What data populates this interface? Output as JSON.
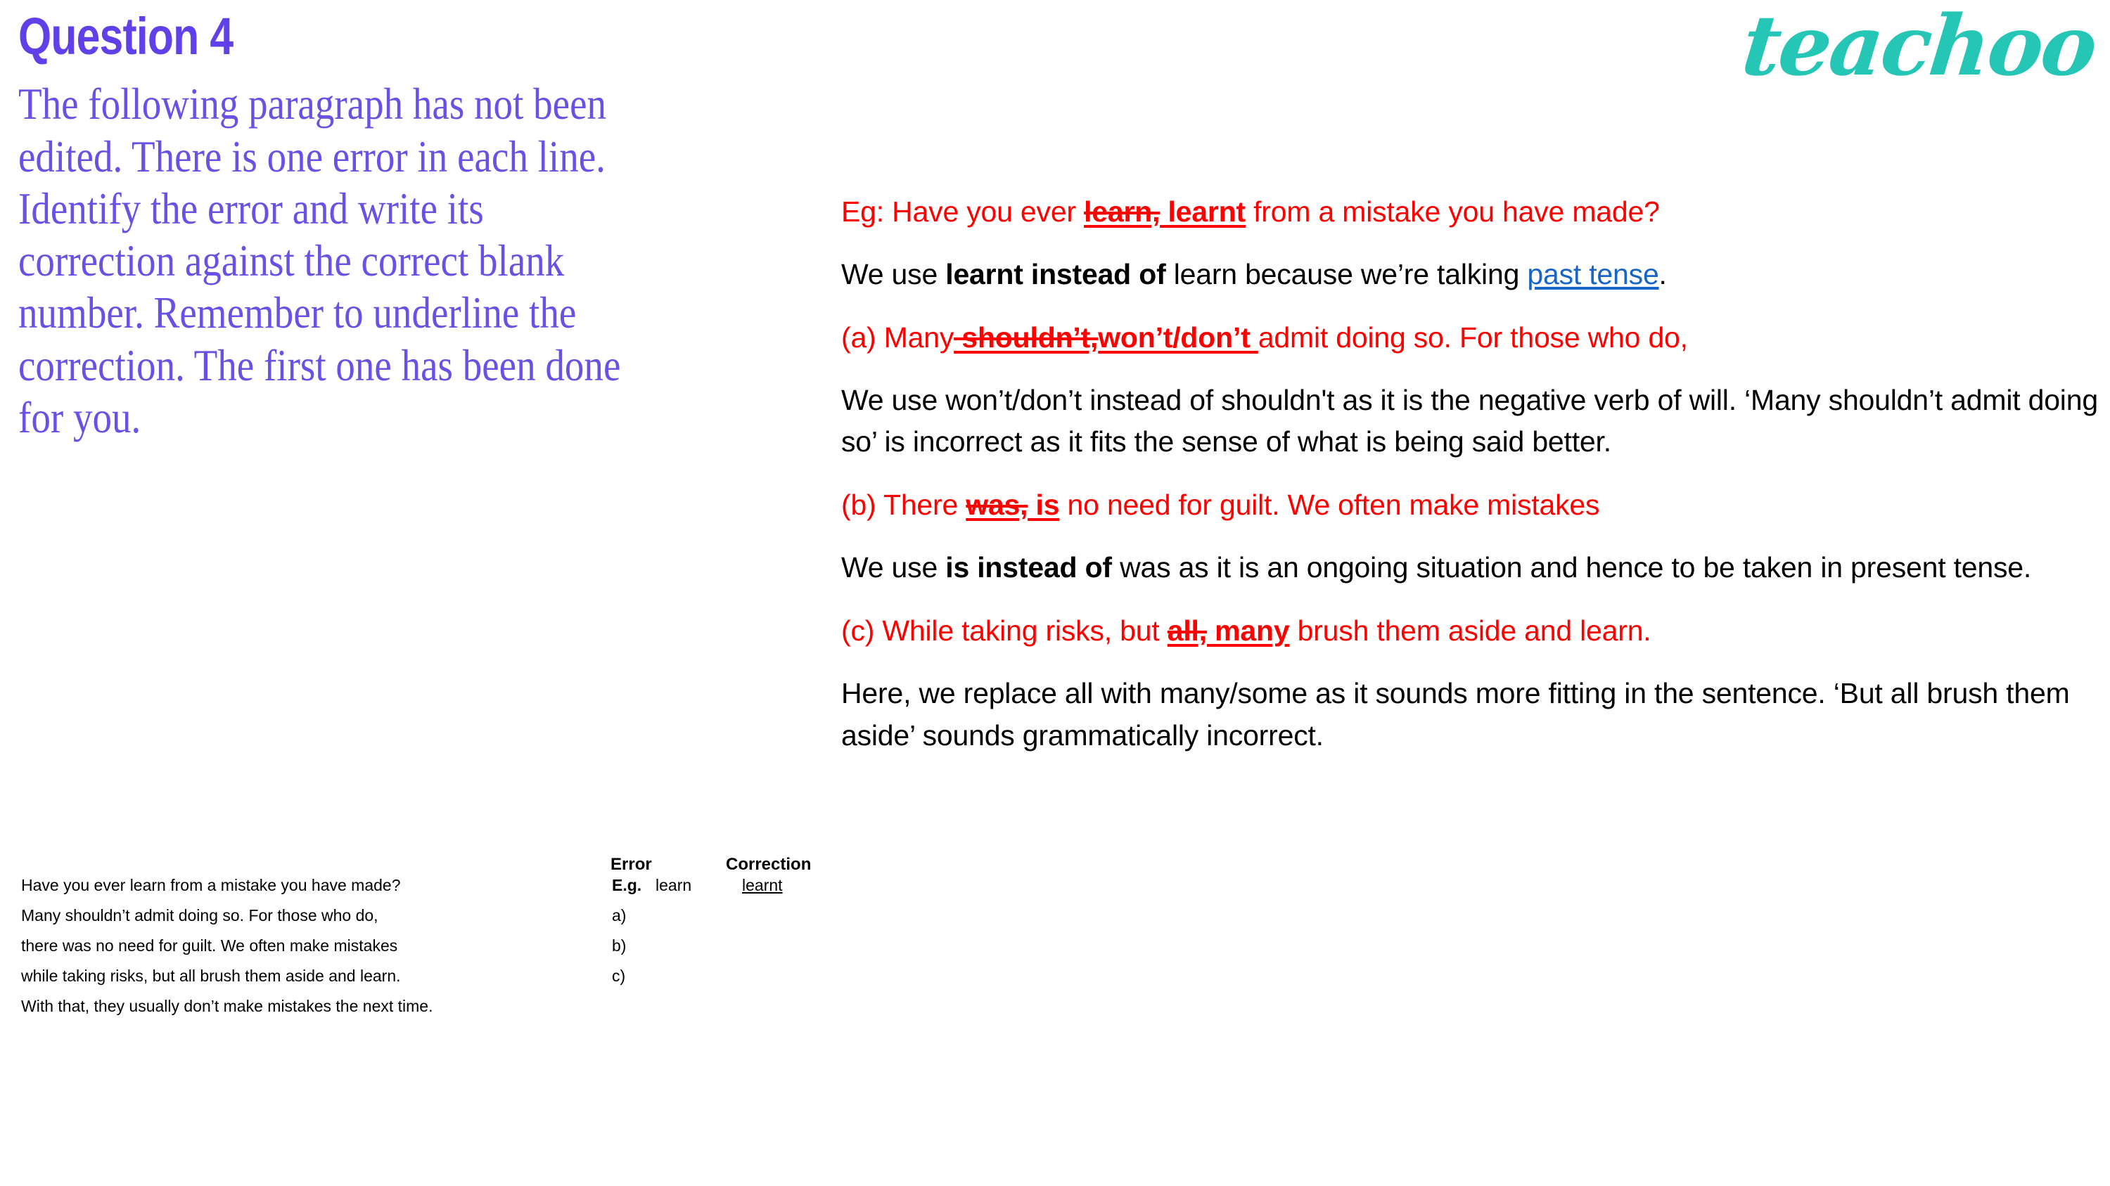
{
  "brand": {
    "logo_text": "teachoo",
    "logo_color": "#26C6B6"
  },
  "colors": {
    "title_purple": "#6040E8",
    "body_purple": "#6A50E4",
    "red": "#FF0000",
    "link_blue": "#1765C6",
    "black": "#000000"
  },
  "left": {
    "title": "Question 4",
    "instructions": "The following paragraph has not been edited. There is one error in each line. Identify the error and write its correction against the correct blank number. Remember to underline the correction. The first one has been done for you."
  },
  "table": {
    "headers": {
      "error": "Error",
      "correction": "Correction"
    },
    "rows": [
      {
        "sentence": "Have you ever learn from a mistake you have made?",
        "label": "E.g.",
        "label_bold": true,
        "error": "learn",
        "correction": "learnt"
      },
      {
        "sentence": "Many shouldn’t admit doing so. For those who do,",
        "label": "a)",
        "label_bold": false,
        "error": "",
        "correction": ""
      },
      {
        "sentence": "there was no need for guilt. We often make mistakes",
        "label": "b)",
        "label_bold": false,
        "error": "",
        "correction": ""
      },
      {
        "sentence": "while taking risks, but all brush them aside and learn.",
        "label": "c)",
        "label_bold": false,
        "error": "",
        "correction": ""
      },
      {
        "sentence": "With that, they usually don’t make mistakes the next time.",
        "label": "",
        "label_bold": false,
        "error": "",
        "correction": ""
      }
    ]
  },
  "answers": {
    "example": {
      "prefix": "Eg: Have you ever ",
      "struck": "learn,",
      "correction": " learnt",
      "suffix": " from a mistake you have made?"
    },
    "example_explanation": {
      "lead": "We use ",
      "bold": "learnt instead of",
      "mid": " learn because we’re talking ",
      "link": "past tense",
      "tail": "."
    },
    "items": [
      {
        "marker": "(a) ",
        "prefix": "Many",
        "struck": " shouldn’t,",
        "correction": "won’t/don’t ",
        "suffix": "admit doing so. For those who do,",
        "explanation": "We use won’t/don’t instead of shouldn't as it is the negative verb of will. ‘Many shouldn’t admit doing so’ is incorrect as it fits the sense of what is being said better."
      },
      {
        "marker": "(b) ",
        "prefix": "There ",
        "struck": "was,",
        "correction": " is",
        "suffix": " no need for guilt. We often make mistakes",
        "explanation_lead": "We use ",
        "explanation_bold": "is instead of",
        "explanation_tail": " was as it is an ongoing situation and hence to be taken in present tense."
      },
      {
        "marker": "(c) ",
        "prefix": "While taking risks, but ",
        "struck": "all,",
        "correction": " many",
        "suffix": " brush them aside and learn.",
        "explanation": "Here, we replace all with many/some as it sounds more fitting in the sentence. ‘But all brush them aside’ sounds grammatically incorrect."
      }
    ]
  }
}
